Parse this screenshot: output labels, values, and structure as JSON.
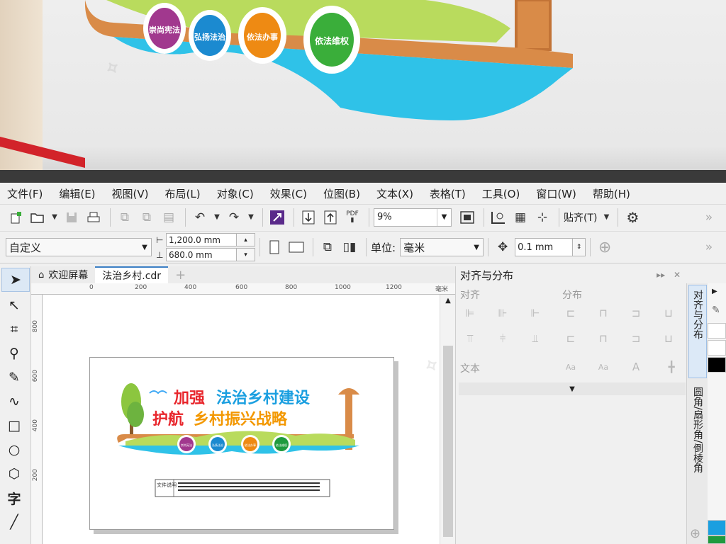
{
  "menu": [
    "文件(F)",
    "编辑(E)",
    "视图(V)",
    "布局(L)",
    "对象(C)",
    "效果(C)",
    "位图(B)",
    "文本(X)",
    "表格(T)",
    "工具(O)",
    "窗口(W)",
    "帮助(H)"
  ],
  "toolbar": {
    "zoom_value": "9%",
    "snap_label": "贴齐(T)",
    "pdf_label": "PDF"
  },
  "propbar": {
    "preset": "自定义",
    "width": "1,200.0 mm",
    "height": "680.0 mm",
    "unit_label": "单位:",
    "unit_value": "毫米",
    "nudge": "0.1 mm"
  },
  "tabs": {
    "welcome": "欢迎屏幕",
    "document": "法治乡村.cdr",
    "add": "+"
  },
  "ruler": {
    "h_ticks": [
      "0",
      "200",
      "400",
      "600",
      "800",
      "1000",
      "1200"
    ],
    "h_unit": "毫米",
    "v_ticks": [
      "800",
      "600",
      "400",
      "200"
    ]
  },
  "artwork": {
    "line1_a": "加强",
    "line1_b": "法治乡村建设",
    "line2_a": "护航",
    "line2_b": "乡村振兴战略",
    "badges": [
      "崇尚宪法",
      "弘扬法治",
      "依法办事",
      "依法维权"
    ],
    "caption_label": "文件说明"
  },
  "photo": {
    "badges": [
      "崇尚宪法",
      "弘扬法治",
      "依法办事",
      "依法维权"
    ]
  },
  "docker": {
    "title": "对齐与分布",
    "section_align": "对齐",
    "section_distribute": "分布",
    "section_text": "文本"
  },
  "vtabs": {
    "tab1": "对齐与分布",
    "tab2": "圆角/扇形角/倒棱角"
  },
  "colors": {
    "accent_blue": "#3c7fc4",
    "art_red": "#e8262c",
    "art_blue": "#1a9fe0",
    "art_orange": "#f39800",
    "art_green": "#3aae3a",
    "badge_purple": "#a1388e",
    "badge_blue": "#1b8ad0",
    "badge_orange": "#ee8a13",
    "badge_green": "#1f9a3e"
  }
}
